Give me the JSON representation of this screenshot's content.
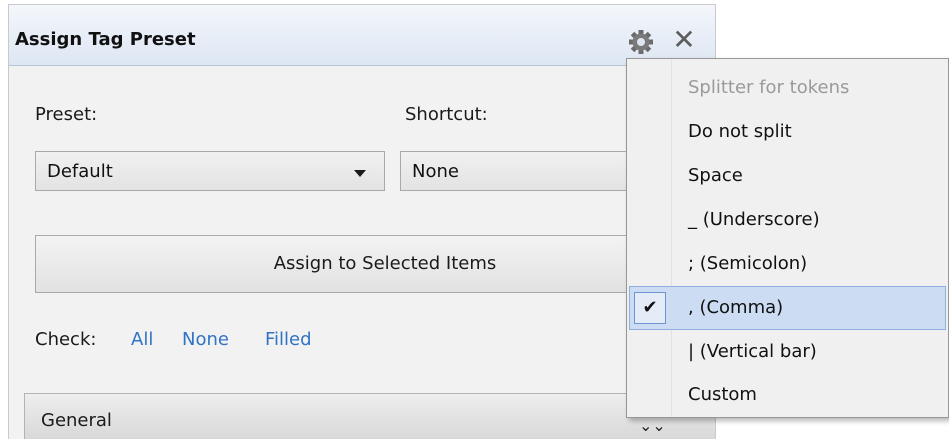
{
  "panel": {
    "title": "Assign Tag Preset",
    "gear_icon": "gear-icon",
    "close_glyph": "✕",
    "preset_label": "Preset:",
    "shortcut_label": "Shortcut:",
    "preset_value": "Default",
    "shortcut_value": "None",
    "assign_button": "Assign to Selected Items",
    "check_label": "Check:",
    "check_links": [
      "All",
      "None",
      "Filled"
    ],
    "group_header": "General",
    "group_chevron": "⌄⌄"
  },
  "menu": {
    "header": "Splitter for tokens",
    "items": [
      {
        "label": "Do not split",
        "checked": false
      },
      {
        "label": "Space",
        "checked": false
      },
      {
        "label": "_ (Underscore)",
        "checked": false
      },
      {
        "label": "; (Semicolon)",
        "checked": false
      },
      {
        "label": ", (Comma)",
        "checked": true
      },
      {
        "label": "| (Vertical bar)",
        "checked": false
      },
      {
        "label": "Custom",
        "checked": false
      }
    ],
    "check_glyph": "✔"
  },
  "colors": {
    "title_gradient_top": "#f4f7fc",
    "title_gradient_bottom": "#dde6f3",
    "link": "#3173c4",
    "menu_selected_bg": "#ccdcf2",
    "menu_header_text": "#9a9a9a"
  }
}
